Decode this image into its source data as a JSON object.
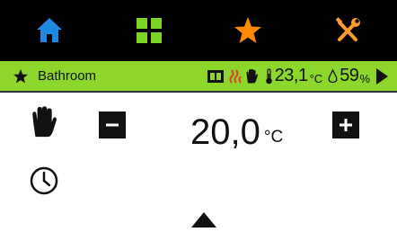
{
  "nav": {
    "items": [
      {
        "icon": "home-icon",
        "color": "#1e88e5"
      },
      {
        "icon": "grid-icon",
        "color": "#7cd62a"
      },
      {
        "icon": "star-icon",
        "color": "#ff8a00"
      },
      {
        "icon": "tools-icon",
        "color": "#ff9a2e"
      }
    ]
  },
  "status": {
    "room": "Bathroom",
    "temperature": "23,1",
    "temperature_unit": "°C",
    "humidity": "59",
    "humidity_unit": "%"
  },
  "main": {
    "setpoint": "20,0",
    "setpoint_unit": "°C"
  },
  "colors": {
    "navbar_bg": "#000000",
    "status_bg": "#8dd62b",
    "heating_red": "#e53935"
  }
}
